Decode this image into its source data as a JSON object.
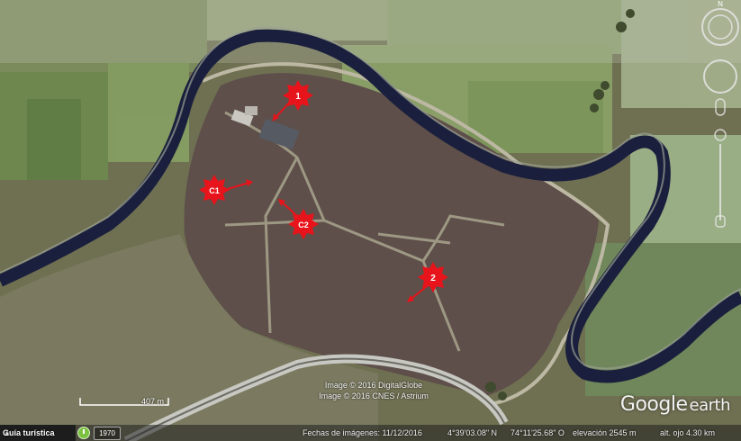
{
  "markers": [
    {
      "id": "m1",
      "label": "1"
    },
    {
      "id": "mc1",
      "label": "C1"
    },
    {
      "id": "mc2",
      "label": "C2"
    },
    {
      "id": "m2",
      "label": "2"
    }
  ],
  "credits": {
    "line1": "Image © 2016 DigitalGlobe",
    "line2": "Image © 2016 CNES / Astrium"
  },
  "logo": {
    "google": "Google",
    "earth": "earth"
  },
  "scale": {
    "label": "407 m"
  },
  "nav": {
    "north_label": "N"
  },
  "statusbar": {
    "tour_label": "Guía turística",
    "year": "1970",
    "imagery_date": "Fechas de imágenes: 11/12/2016",
    "latitude": "4°39'03.08\" N",
    "longitude": "74°11'25.68\" O",
    "elevation": "elevación 2545 m",
    "eye_alt": "alt. ojo 4.30 km"
  },
  "colors": {
    "marker": "#e8141b",
    "river": "#1a1f3d",
    "field": "#5b5a45"
  }
}
